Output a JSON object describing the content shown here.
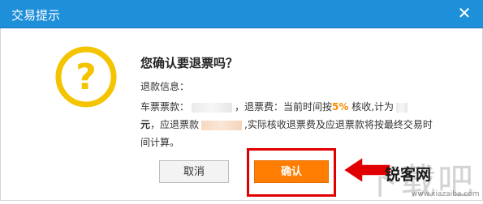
{
  "window": {
    "title": "交易提示",
    "close_glyph": "✕"
  },
  "icon": {
    "name": "question-icon",
    "glyph": "?",
    "color": "#f4c400"
  },
  "prompt": {
    "question": "您确认要退票吗？",
    "info_label": "退款信息：",
    "seg1": "车票票款：",
    "seg2": "，退票费：当前时间按",
    "percent": "5%",
    "seg3": "核收,计为",
    "unit": "元",
    "seg4": "，应退票款",
    "seg5": ",实际核收退票费及应退票款将按最终交易时间计算。"
  },
  "buttons": {
    "cancel": "取消",
    "confirm": "确认"
  },
  "watermark": {
    "big": "下载吧",
    "logo": "锐客网",
    "url": "www.xiazaiba.com"
  },
  "colors": {
    "titlebar": "#1e8fd9",
    "accent": "#ff7d00",
    "highlight_box": "#e10000"
  }
}
